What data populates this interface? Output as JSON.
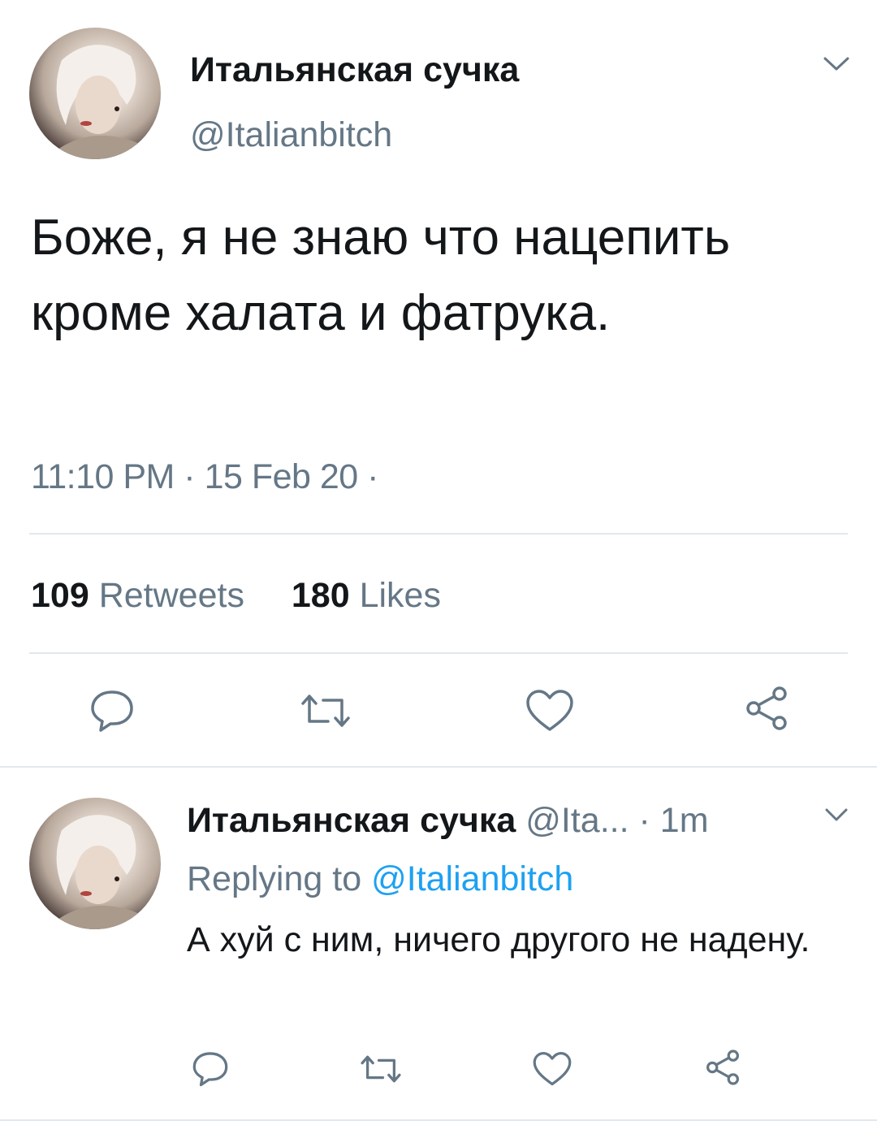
{
  "main_tweet": {
    "display_name": "Итальянская сучка",
    "handle": "@Italianbitch",
    "text": "Боже, я не знаю что нацепить кроме халата и фатрука.",
    "timestamp": "11:10 PM · 15 Feb 20 ·",
    "retweets_count": "109",
    "retweets_label": "Retweets",
    "likes_count": "180",
    "likes_label": "Likes"
  },
  "reply_tweet": {
    "display_name": "Итальянская сучка",
    "handle_truncated": "@Ita...",
    "time_ago": "· 1m",
    "replying_prefix": "Replying to",
    "replying_handle": "@Italianbitch",
    "text": "А хуй с ним, ничего другого не надену."
  },
  "icons": {
    "more": "chevron-down-icon",
    "reply": "reply-bubble-icon",
    "retweet": "retweet-icon",
    "like": "heart-icon",
    "share": "share-icon"
  },
  "colors": {
    "text": "#14171a",
    "secondary": "#657786",
    "link": "#1da1f2",
    "divider": "#e1e8ed",
    "icon": "#657786"
  }
}
